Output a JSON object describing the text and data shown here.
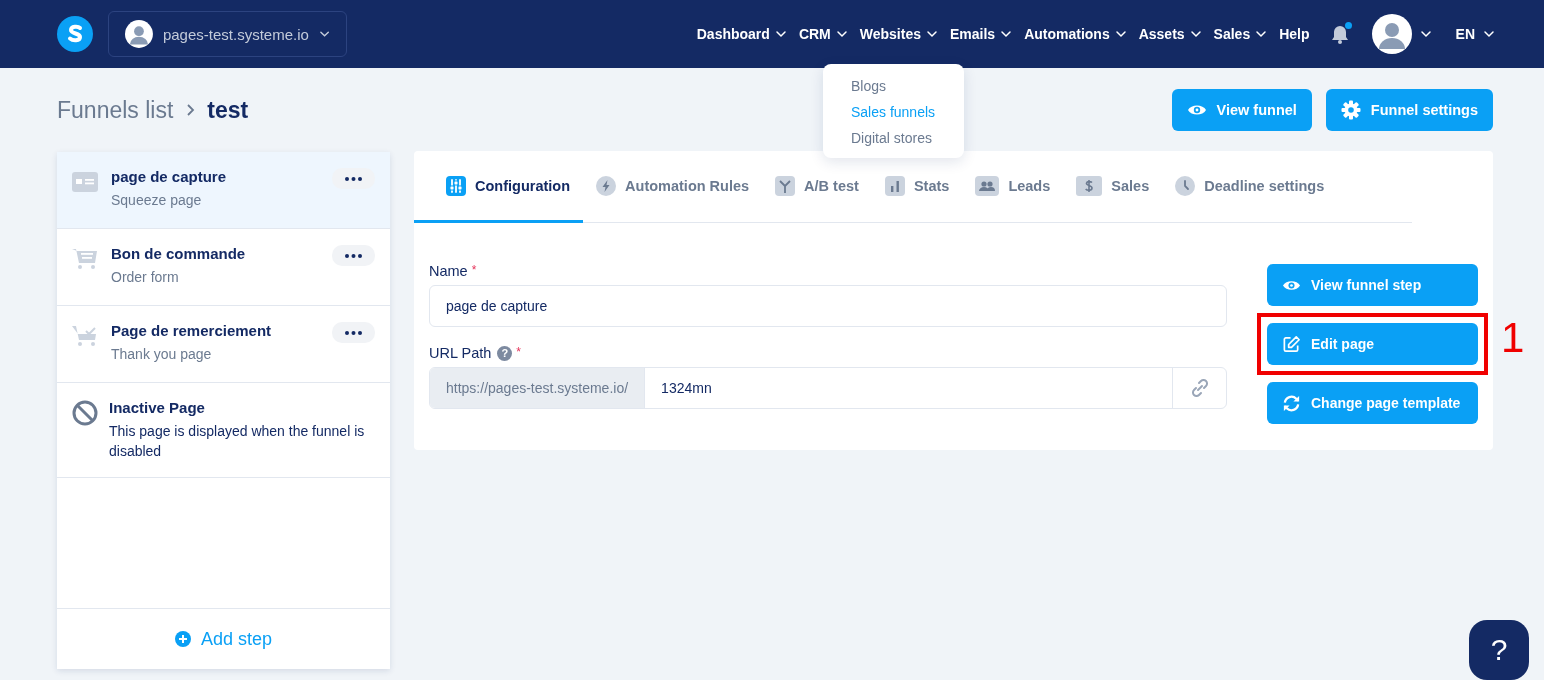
{
  "topbar": {
    "site": "pages-test.systeme.io",
    "nav": [
      {
        "label": "Dashboard",
        "dropdown": true
      },
      {
        "label": "CRM",
        "dropdown": true
      },
      {
        "label": "Websites",
        "dropdown": true
      },
      {
        "label": "Emails",
        "dropdown": true
      },
      {
        "label": "Automations",
        "dropdown": true
      },
      {
        "label": "Assets",
        "dropdown": true
      },
      {
        "label": "Sales",
        "dropdown": true
      },
      {
        "label": "Help",
        "dropdown": false
      }
    ],
    "notification_dot": true,
    "language": "EN"
  },
  "websites_menu": {
    "items": [
      {
        "label": "Blogs",
        "selected": false
      },
      {
        "label": "Sales funnels",
        "selected": true
      },
      {
        "label": "Digital stores",
        "selected": false
      }
    ]
  },
  "breadcrumb": {
    "parent": "Funnels list",
    "current": "test"
  },
  "header_buttons": [
    {
      "label": "View funnel"
    },
    {
      "label": "Funnel settings"
    }
  ],
  "steps": [
    {
      "kind": "squeeze",
      "title": "page de capture",
      "subtitle": "Squeeze page",
      "selected": true,
      "menu": true
    },
    {
      "kind": "order",
      "title": "Bon de commande",
      "subtitle": "Order form",
      "selected": false,
      "menu": true
    },
    {
      "kind": "thanks",
      "title": "Page de remerciement",
      "subtitle": "Thank you page",
      "selected": false,
      "menu": true
    },
    {
      "kind": "inactive",
      "title": "Inactive Page",
      "subtitle": "This page is displayed when the funnel is disabled",
      "selected": false,
      "menu": false
    }
  ],
  "add_step": "Add step",
  "tabs": [
    {
      "label": "Configuration",
      "selected": true
    },
    {
      "label": "Automation Rules",
      "selected": false
    },
    {
      "label": "A/B test",
      "selected": false
    },
    {
      "label": "Stats",
      "selected": false
    },
    {
      "label": "Leads",
      "selected": false
    },
    {
      "label": "Sales",
      "selected": false
    },
    {
      "label": "Deadline settings",
      "selected": false
    }
  ],
  "form": {
    "name_label": "Name",
    "name_required": "*",
    "name_value": "page de capture",
    "url_label": "URL Path",
    "url_hint": "?",
    "url_required": "*",
    "url_prefix": "https://pages-test.systeme.io/",
    "url_value": "1324mn"
  },
  "actions": [
    {
      "label": "View funnel step"
    },
    {
      "label": "Edit page",
      "annotation": "1"
    },
    {
      "label": "Change page template"
    }
  ],
  "help_button": "?"
}
